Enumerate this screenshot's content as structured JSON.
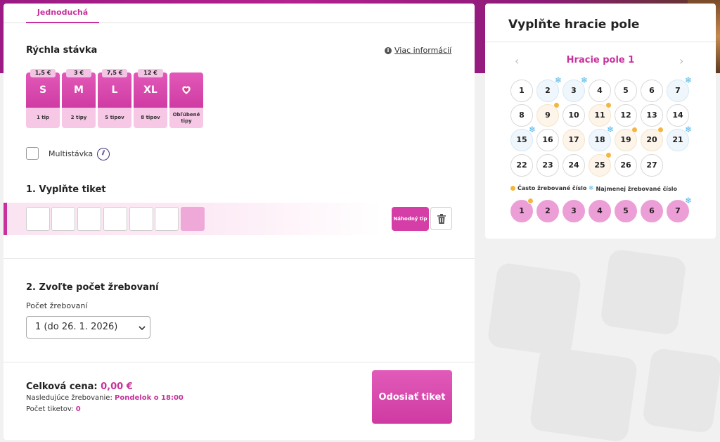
{
  "main": {
    "tab": "Jednoduchá",
    "quick_bet": {
      "title": "Rýchla stávka",
      "more_info": "Viac informácií",
      "cards": [
        {
          "price": "1,5 €",
          "label": "S",
          "tips": "1 tip"
        },
        {
          "price": "3 €",
          "label": "M",
          "tips": "2 tipy"
        },
        {
          "price": "7,5 €",
          "label": "L",
          "tips": "5 tipov"
        },
        {
          "price": "12 €",
          "label": "XL",
          "tips": "8 tipov"
        }
      ],
      "favorite_label": "Obľúbené tipy"
    },
    "multibet_label": "Multistávka",
    "step1_title": "1. Vyplňte tiket",
    "random_tip": "Náhodný tip",
    "step2_title": "2. Zvoľte počet žrebovaní",
    "draws_label": "Počet žrebovaní",
    "draws_value": "1 (do 26. 1. 2026)",
    "total_label": "Celková cena:",
    "total_value": "0,00 €",
    "next_draw_label": "Nasledujúce žrebovanie:",
    "next_draw_value": "Pondelok o 18:00",
    "tickets_label": "Počet tiketov:",
    "tickets_value": "0",
    "submit": "Odosiať tiket"
  },
  "side": {
    "title": "Vyplňte hracie pole",
    "field_title": "Hracie pole 1",
    "prev": "‹",
    "next": "›",
    "numbers": [
      "1",
      "2",
      "3",
      "4",
      "5",
      "6",
      "7",
      "8",
      "9",
      "10",
      "11",
      "12",
      "13",
      "14",
      "15",
      "16",
      "17",
      "18",
      "19",
      "20",
      "21",
      "22",
      "23",
      "24",
      "25",
      "26",
      "27"
    ],
    "legend_hot": "Často žrebované číslo",
    "legend_cold": "Najmenej žrebované číslo",
    "extra_numbers": [
      "1",
      "2",
      "3",
      "4",
      "5",
      "6",
      "7"
    ],
    "colors": {
      "accent": "#c8319c",
      "hot": "#f3b63f",
      "cold": "#4fb3e8"
    }
  }
}
